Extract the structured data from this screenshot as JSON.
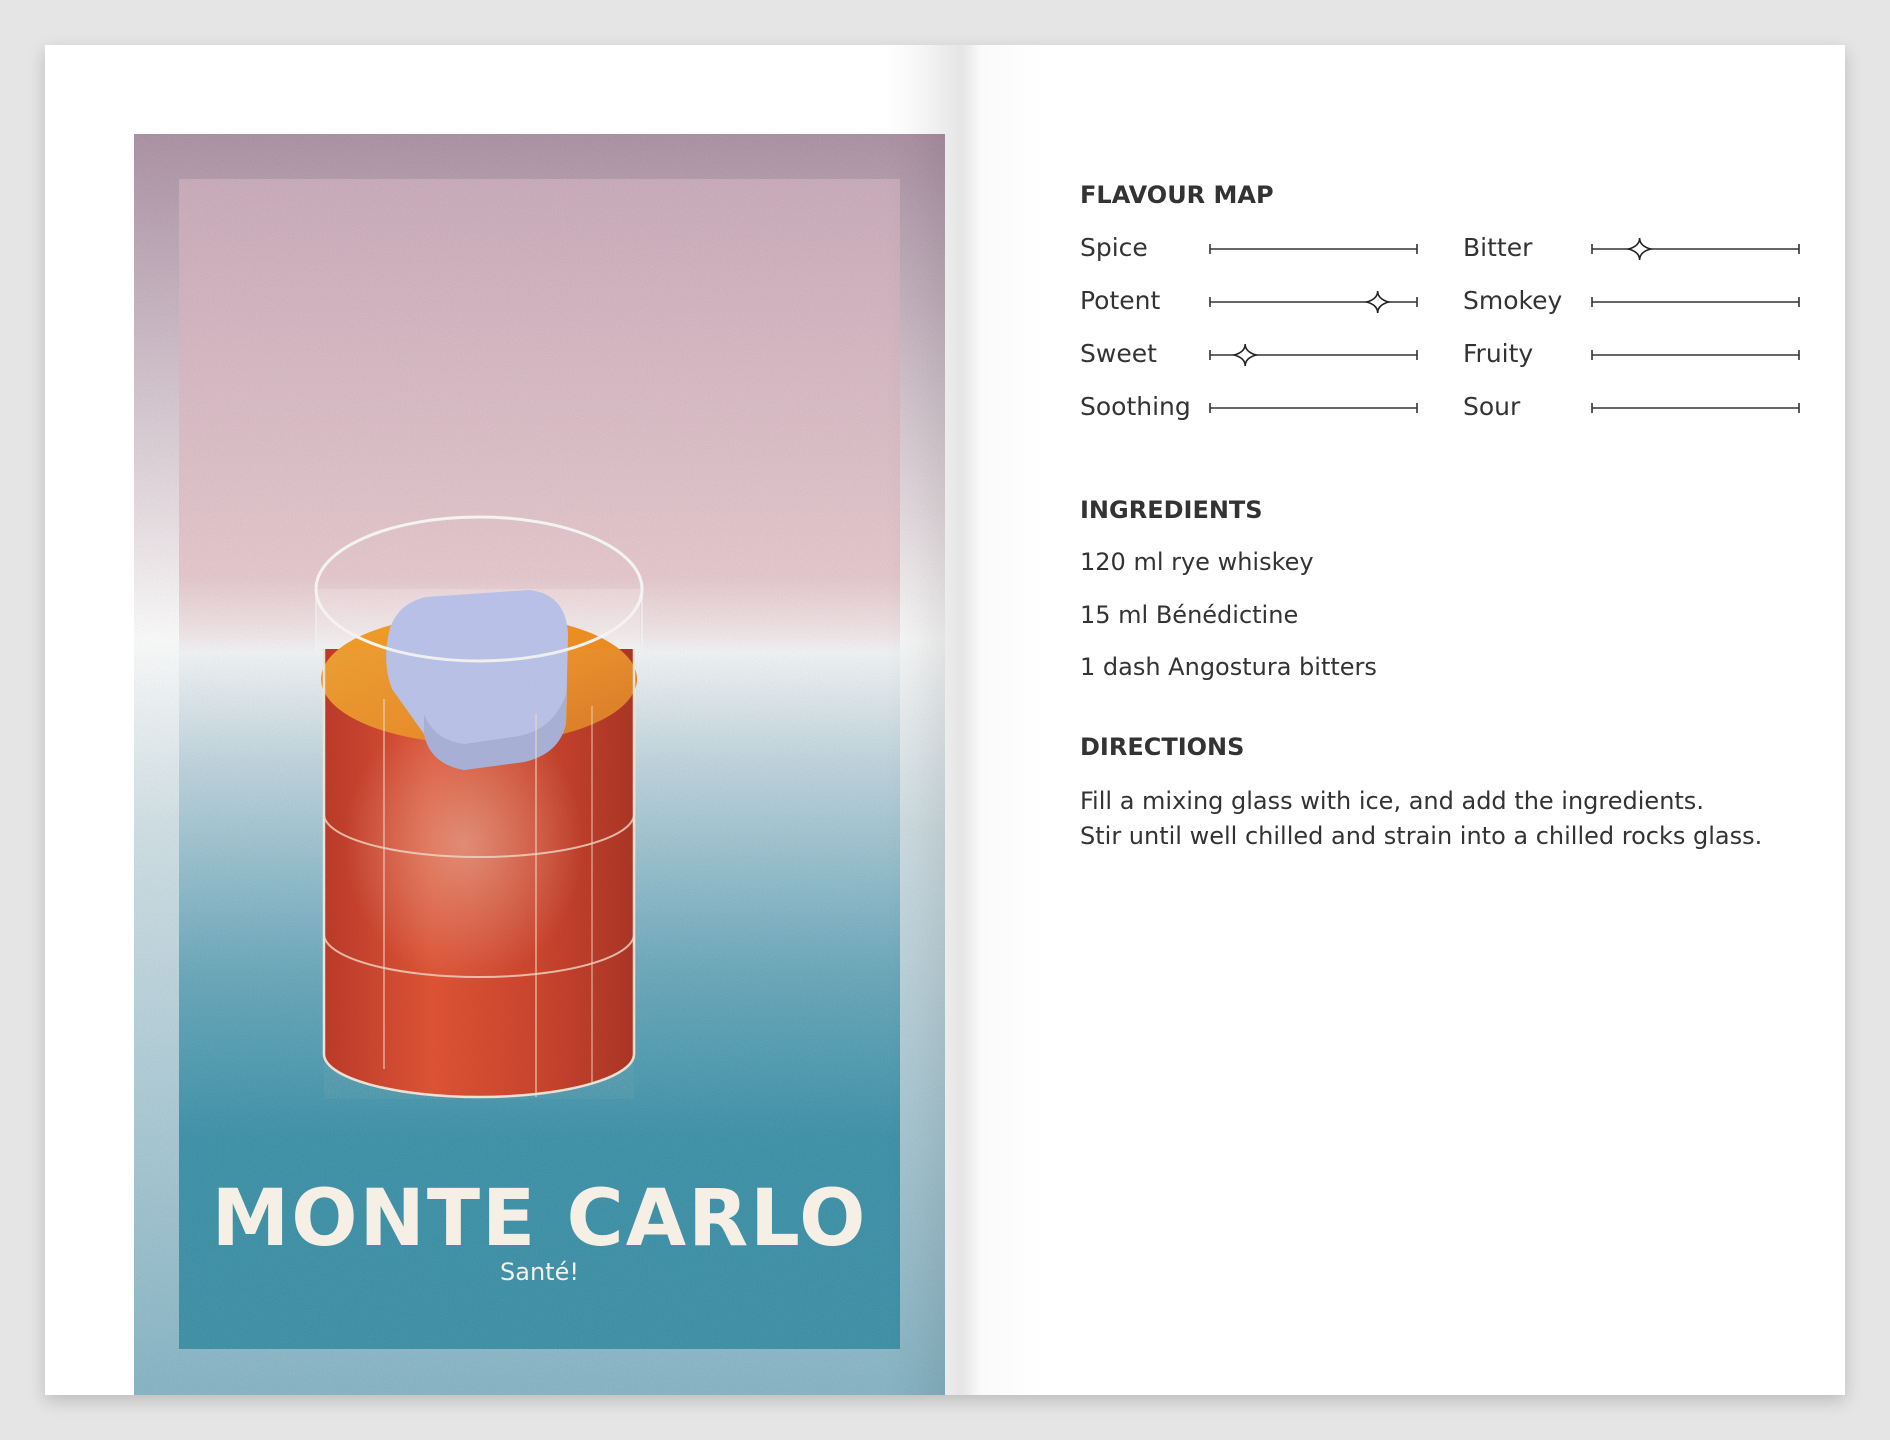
{
  "poster": {
    "title": "MONTE CARLO",
    "subtitle": "Santé!",
    "colors": {
      "pink": "#ccaab8",
      "teal": "#2b8aa4",
      "drink": "#cf3e24",
      "amber": "#ee9a22",
      "ice": "#b7bfe6",
      "cream": "#f6efe6"
    }
  },
  "flavour_map": {
    "heading": "FLAVOUR MAP",
    "marker_icon": "sparkle-icon",
    "left": [
      {
        "label": "Spice",
        "value": null
      },
      {
        "label": "Potent",
        "value": 0.81
      },
      {
        "label": "Sweet",
        "value": 0.17
      },
      {
        "label": "Soothing",
        "value": null
      }
    ],
    "right": [
      {
        "label": "Bitter",
        "value": 0.23
      },
      {
        "label": "Smokey",
        "value": null
      },
      {
        "label": "Fruity",
        "value": null
      },
      {
        "label": "Sour",
        "value": null
      }
    ]
  },
  "ingredients": {
    "heading": "INGREDIENTS",
    "items": [
      "120 ml rye whiskey",
      "15 ml Bénédictine",
      "1 dash Angostura bitters"
    ]
  },
  "directions": {
    "heading": "DIRECTIONS",
    "lines": [
      "Fill a mixing glass with ice, and add the ingredients.",
      "Stir until well chilled and strain into a chilled rocks glass."
    ]
  }
}
